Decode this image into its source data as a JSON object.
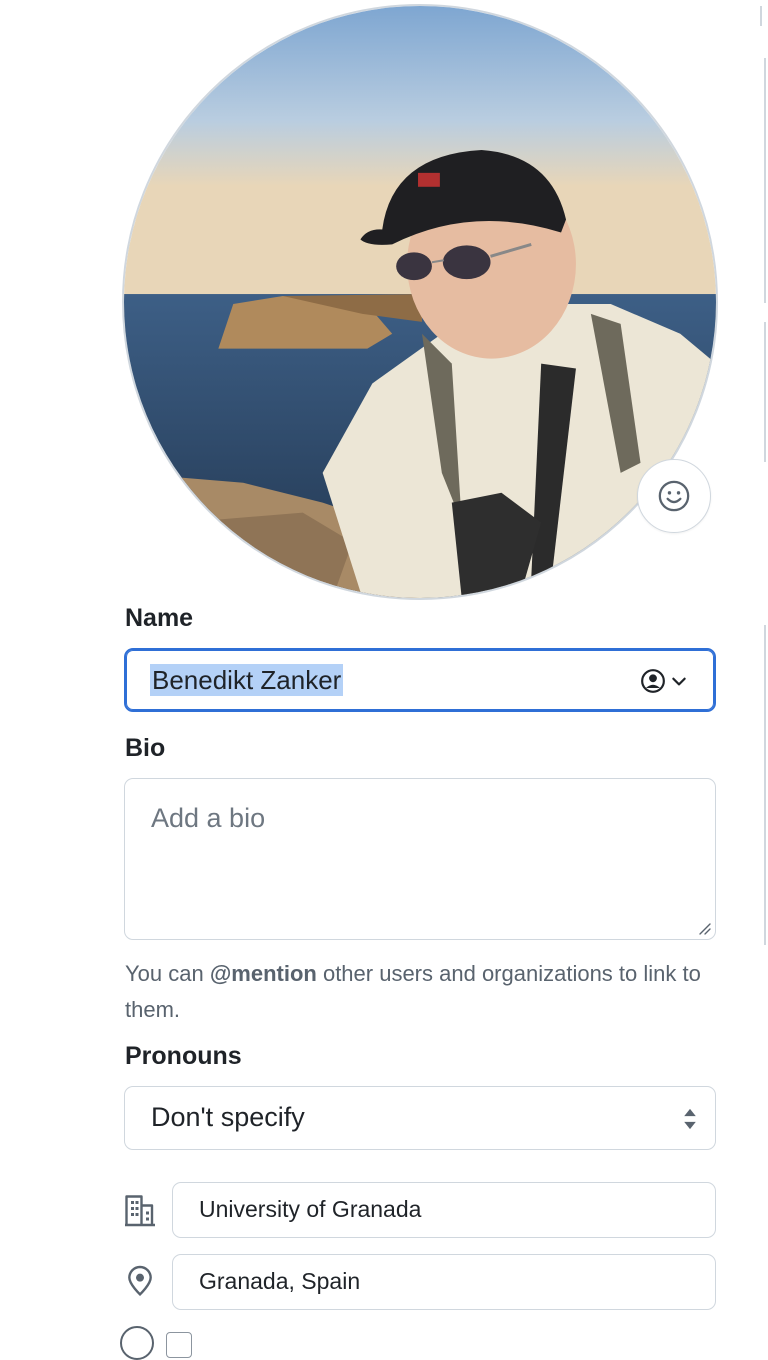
{
  "profile": {
    "avatar_alt": "Profile picture",
    "emoji_icon": "smiley-icon",
    "name_label": "Name",
    "name_value": "Benedikt Zanker",
    "bio_label": "Bio",
    "bio_placeholder": "Add a bio",
    "note_prefix": "You can ",
    "note_mention": "@mention",
    "note_suffix": " other users and organizations to link to them.",
    "pronouns_label": "Pronouns",
    "pronouns_value": "Don't specify",
    "company_icon": "organization-icon",
    "company_value": "University of Granada",
    "location_icon": "location-icon",
    "location_value": "Granada, Spain"
  },
  "colors": {
    "focus_border": "#2f6fd6",
    "selection": "#b4d1f7",
    "muted_text": "#59636e",
    "border": "#d0d7de"
  }
}
